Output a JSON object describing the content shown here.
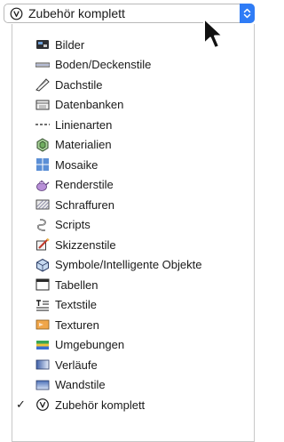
{
  "popup": {
    "selected_label": "Zubehör komplett",
    "icon": "circled-v-icon",
    "stepper_icon": "chevron-up-down-icon",
    "accent_color": "#2f7cf6"
  },
  "menu": {
    "items": [
      {
        "label": "Bilder",
        "icon": "image-icon"
      },
      {
        "label": "Boden/Deckenstile",
        "icon": "slab-icon"
      },
      {
        "label": "Dachstile",
        "icon": "roof-icon"
      },
      {
        "label": "Datenbanken",
        "icon": "database-icon"
      },
      {
        "label": "Linienarten",
        "icon": "dashed-line-icon"
      },
      {
        "label": "Materialien",
        "icon": "material-icon"
      },
      {
        "label": "Mosaike",
        "icon": "mosaic-icon"
      },
      {
        "label": "Renderstile",
        "icon": "teapot-icon"
      },
      {
        "label": "Schraffuren",
        "icon": "hatch-icon"
      },
      {
        "label": "Scripts",
        "icon": "script-icon"
      },
      {
        "label": "Skizzenstile",
        "icon": "sketch-icon"
      },
      {
        "label": "Symbole/Intelligente Objekte",
        "icon": "symbol-icon"
      },
      {
        "label": "Tabellen",
        "icon": "table-icon"
      },
      {
        "label": "Textstile",
        "icon": "text-style-icon"
      },
      {
        "label": "Texturen",
        "icon": "texture-icon"
      },
      {
        "label": "Umgebungen",
        "icon": "environment-icon"
      },
      {
        "label": "Verläufe",
        "icon": "gradient-icon"
      },
      {
        "label": "Wandstile",
        "icon": "wall-icon"
      },
      {
        "label": "Zubehör komplett",
        "icon": "circled-v-icon",
        "checked": true,
        "check_mark": "✓"
      }
    ]
  }
}
